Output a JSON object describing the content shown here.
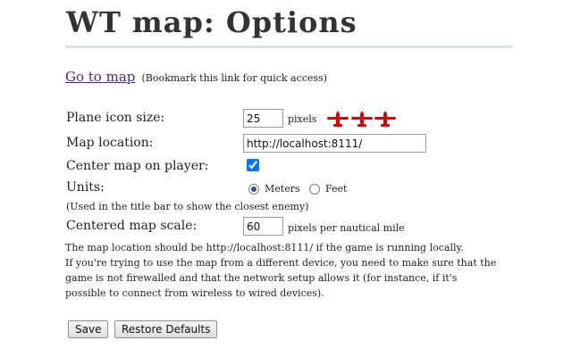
{
  "page": {
    "title": "WT map: Options"
  },
  "goto": {
    "link_text": "Go to map",
    "note": "(Bookmark this link for quick access)"
  },
  "plane_icon_size": {
    "label": "Plane icon size:",
    "value": "25",
    "unit": "pixels",
    "icon_name": "plane-icon",
    "icon_count": 3,
    "icon_color": "#e00000"
  },
  "map_location": {
    "label": "Map location:",
    "value": "http://localhost:8111/"
  },
  "center_map": {
    "label": "Center map on player:",
    "checked": true
  },
  "units": {
    "label": "Units:",
    "note": "(Used in the title bar to show the closest enemy)",
    "options": [
      "Meters",
      "Feet"
    ],
    "selected": "Meters"
  },
  "map_scale": {
    "label": "Centered map scale:",
    "value": "60",
    "unit": "pixels per nautical mile"
  },
  "info": {
    "line1": "The map location should be http://localhost:8111/ if the game is running locally.",
    "line2": "If you're trying to use the map from a different device, you need to make sure that the",
    "line3": "game is not firewalled and that the network setup allows it (for instance, if it's",
    "line4": "possible to connect from wireless to wired devices)."
  },
  "buttons": {
    "save": "Save",
    "restore": "Restore Defaults"
  },
  "colors": {
    "link": "#4b2a86",
    "rule": "#d6e0e6",
    "plane": "#e00000"
  }
}
